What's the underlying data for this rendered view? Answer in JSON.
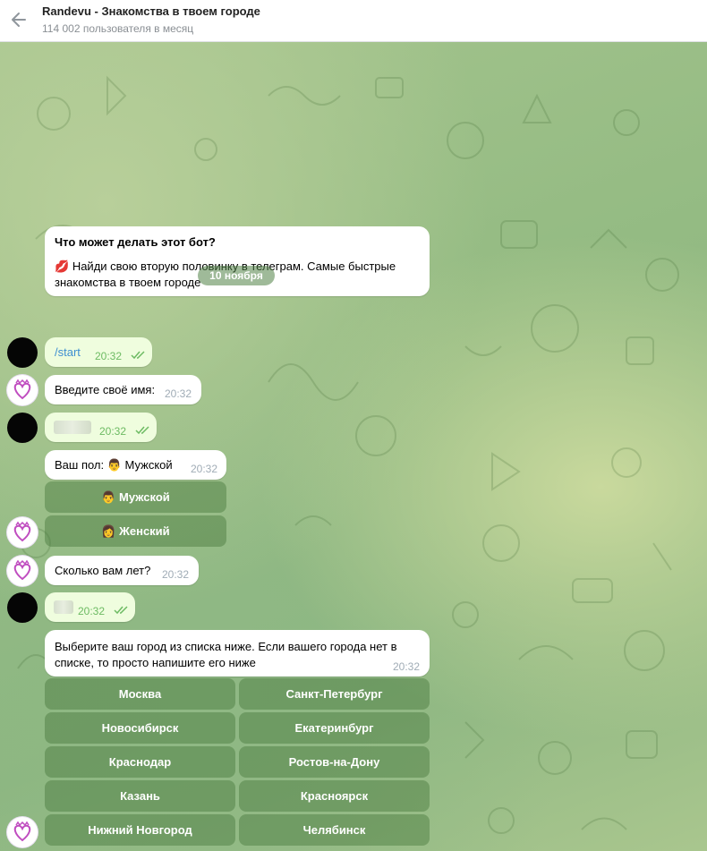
{
  "header": {
    "title": "Randevu - Знакомства в твоем городе",
    "subtitle": "114 002 пользователя в месяц"
  },
  "intro": {
    "title": "Что может делать этот бот?",
    "emoji": "💋",
    "text_line1": "Найди свою вторую половинку в телеграм. Самые быстрые",
    "text_line2": "знакомства в твоем городе"
  },
  "date_separator": "10 ноября",
  "messages": {
    "start": {
      "text": "/start",
      "time": "20:32"
    },
    "ask_name": {
      "text": "Введите своё имя:",
      "time": "20:32"
    },
    "name_reply": {
      "time": "20:32"
    },
    "gender": {
      "text": "Ваш пол: 👨 Мужской",
      "time": "20:32"
    },
    "ask_age": {
      "text": "Сколько вам лет?",
      "time": "20:32"
    },
    "age_reply": {
      "time": "20:32"
    },
    "ask_city": {
      "line1": "Выберите ваш город из списка ниже. Если вашего города нет в",
      "line2": "списке, то просто напишите его ниже",
      "time": "20:32"
    }
  },
  "gender_buttons": [
    "👨 Мужской",
    "👩 Женский"
  ],
  "city_buttons": [
    "Москва",
    "Санкт-Петербург",
    "Новосибирск",
    "Екатеринбург",
    "Краснодар",
    "Ростов-на-Дону",
    "Казань",
    "Красноярск",
    "Нижний Новгород",
    "Челябинск"
  ],
  "colors": {
    "accent": "#3d8fd1",
    "out_bubble": "#effdde",
    "check": "#6dbb63",
    "keyboard_button": "#5c8c50"
  }
}
